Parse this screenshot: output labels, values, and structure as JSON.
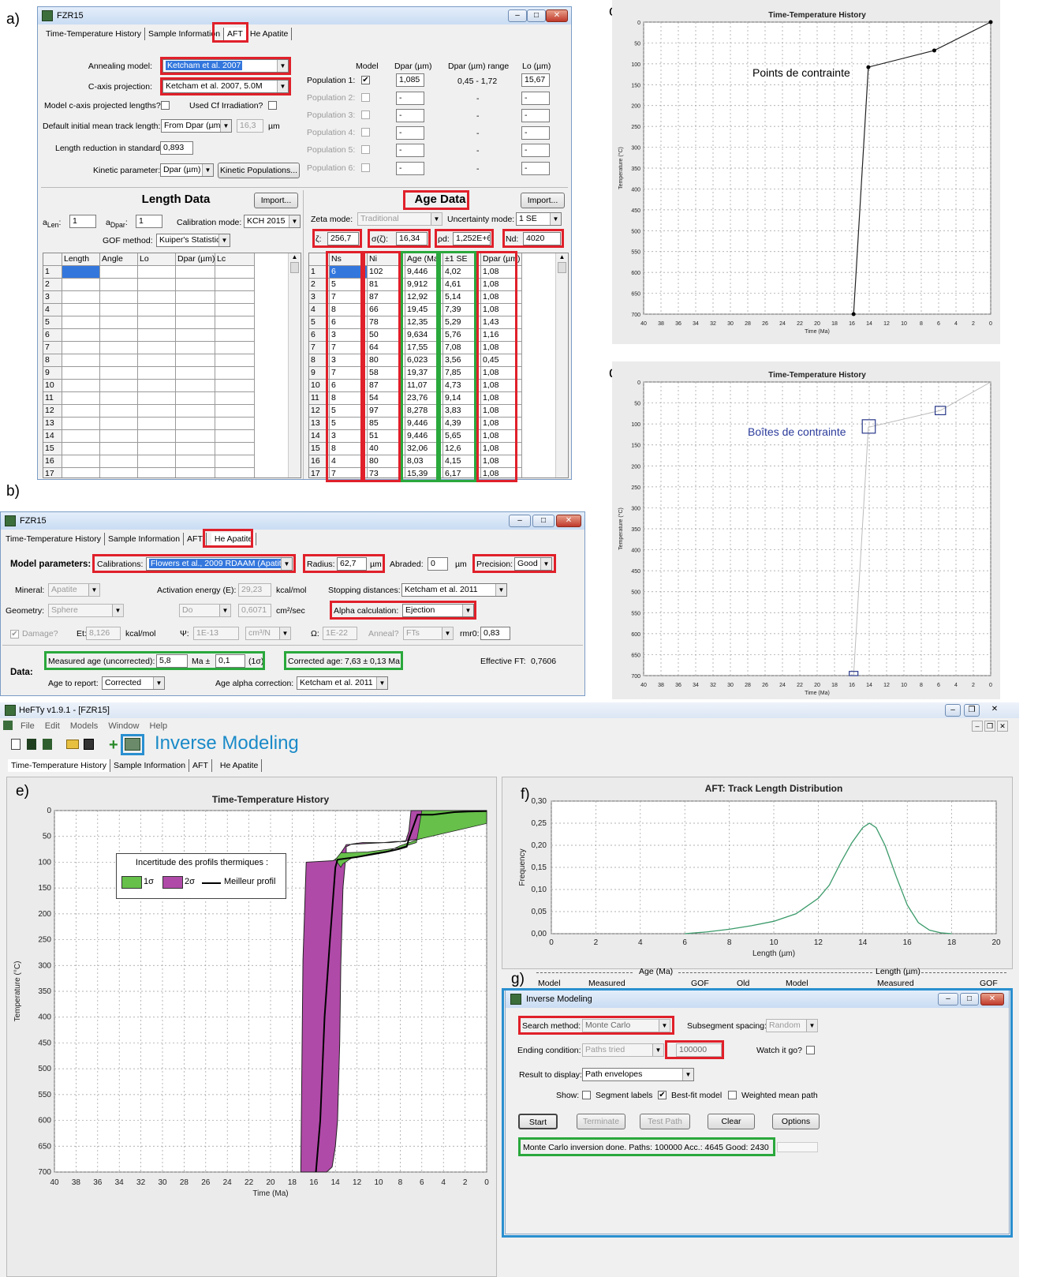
{
  "panel_labels": {
    "a": "a)",
    "b": "b)",
    "c": "c)",
    "d": "d)",
    "e": "e)",
    "f": "f)",
    "g": "g)"
  },
  "aft": {
    "title": "FZR15",
    "tabs": [
      "Time-Temperature History",
      "Sample Information",
      "AFT",
      "He Apatite"
    ],
    "annealing_label": "Annealing model:",
    "annealing_value": "Ketcham et al. 2007",
    "caxis_label": "C-axis projection:",
    "caxis_value": "Ketcham et al. 2007, 5.0M",
    "model_caxis_label": "Model c-axis projected lengths?",
    "used_cf_label": "Used Cf Irradiation?",
    "default_len_label": "Default initial mean track length:",
    "default_len_value": "From Dpar (µm)",
    "default_len_num": "16,3",
    "default_len_unit": "µm",
    "length_red_label": "Length reduction in standard:",
    "length_red_value": "0,893",
    "kinetic_label": "Kinetic parameter:",
    "kinetic_value": "Dpar (µm)",
    "kinetic_btn": "Kinetic Populations...",
    "pop_headers": [
      "Model",
      "Dpar (µm)",
      "Dpar (µm) range",
      "Lo (µm)"
    ],
    "populations": [
      {
        "name": "Population 1:",
        "checked": "✔",
        "dpar": "1,085",
        "range": "0,45 - 1,72",
        "lo": "15,67"
      },
      {
        "name": "Population 2:",
        "checked": "",
        "dpar": "-",
        "range": "-",
        "lo": "-"
      },
      {
        "name": "Population 3:",
        "checked": "",
        "dpar": "-",
        "range": "-",
        "lo": "-"
      },
      {
        "name": "Population 4:",
        "checked": "",
        "dpar": "-",
        "range": "-",
        "lo": "-"
      },
      {
        "name": "Population 5:",
        "checked": "",
        "dpar": "-",
        "range": "-",
        "lo": "-"
      },
      {
        "name": "Population 6:",
        "checked": "",
        "dpar": "-",
        "range": "-",
        "lo": "-"
      }
    ],
    "length_data": {
      "title": "Length Data",
      "import": "Import...",
      "alen_label": "a",
      "alen_sub": "Len",
      "alen_value": "1",
      "adpar_label": "a",
      "adpar_sub": "Dpar",
      "adpar_value": "1",
      "calib_label": "Calibration mode:",
      "calib_value": "KCH 2015",
      "gof_label": "GOF method:",
      "gof_value": "Kuiper's Statistic",
      "headers": [
        "Length",
        "Angle",
        "Lo",
        "Dpar (µm)",
        "Lc"
      ],
      "rows": [
        "1",
        "2",
        "3",
        "4",
        "5",
        "6",
        "7",
        "8",
        "9",
        "10",
        "11",
        "12",
        "13",
        "14",
        "15",
        "16",
        "17"
      ]
    },
    "age_data": {
      "title": "Age Data",
      "import": "Import...",
      "zeta_mode_label": "Zeta mode:",
      "zeta_mode_value": "Traditional",
      "unc_label": "Uncertainty mode:",
      "unc_value": "1 SE",
      "zeta_label": "ζ:",
      "zeta_value": "256,7",
      "szeta_label": "σ(ζ):",
      "szeta_value": "16,34",
      "rho_label": "ρd:",
      "rho_value": "1,252E+6",
      "nd_label": "Nd:",
      "nd_value": "4020",
      "headers": [
        "Ns",
        "Ni",
        "Age (Ma)",
        "±1 SE",
        "Dpar (µm)"
      ],
      "rows": [
        [
          "1",
          "6",
          "102",
          "9,446",
          "4,02",
          "1,08"
        ],
        [
          "2",
          "5",
          "81",
          "9,912",
          "4,61",
          "1,08"
        ],
        [
          "3",
          "7",
          "87",
          "12,92",
          "5,14",
          "1,08"
        ],
        [
          "4",
          "8",
          "66",
          "19,45",
          "7,39",
          "1,08"
        ],
        [
          "5",
          "6",
          "78",
          "12,35",
          "5,29",
          "1,43"
        ],
        [
          "6",
          "3",
          "50",
          "9,634",
          "5,76",
          "1,16"
        ],
        [
          "7",
          "7",
          "64",
          "17,55",
          "7,08",
          "1,08"
        ],
        [
          "8",
          "3",
          "80",
          "6,023",
          "3,56",
          "0,45"
        ],
        [
          "9",
          "7",
          "58",
          "19,37",
          "7,85",
          "1,08"
        ],
        [
          "10",
          "6",
          "87",
          "11,07",
          "4,73",
          "1,08"
        ],
        [
          "11",
          "8",
          "54",
          "23,76",
          "9,14",
          "1,08"
        ],
        [
          "12",
          "5",
          "97",
          "8,278",
          "3,83",
          "1,08"
        ],
        [
          "13",
          "5",
          "85",
          "9,446",
          "4,39",
          "1,08"
        ],
        [
          "14",
          "3",
          "51",
          "9,446",
          "5,65",
          "1,08"
        ],
        [
          "15",
          "8",
          "40",
          "32,06",
          "12,6",
          "1,08"
        ],
        [
          "16",
          "4",
          "80",
          "8,03",
          "4,15",
          "1,08"
        ],
        [
          "17",
          "7",
          "73",
          "15,39",
          "6,17",
          "1,08"
        ]
      ]
    }
  },
  "he": {
    "title": "FZR15",
    "tabs": [
      "Time-Temperature History",
      "Sample Information",
      "AFT",
      "He Apatite"
    ],
    "model_params": "Model parameters:",
    "calib_label": "Calibrations:",
    "calib_value": "Flowers et al., 2009 RDAAM (Apatite)",
    "radius_label": "Radius:",
    "radius_value": "62,7",
    "radius_unit": "µm",
    "abraded_label": "Abraded:",
    "abraded_value": "0",
    "abraded_unit": "µm",
    "precision_label": "Precision:",
    "precision_value": "Good",
    "mineral_label": "Mineral:",
    "mineral_value": "Apatite",
    "act_label": "Activation energy (E):",
    "act_value": "29,23",
    "act_unit": "kcal/mol",
    "stop_label": "Stopping distances:",
    "stop_value": "Ketcham et al. 2011",
    "geom_label": "Geometry:",
    "geom_value": "Sphere",
    "do_value": "Do",
    "do_num": "0,6071",
    "do_unit": "cm²/sec",
    "alpha_label": "Alpha calculation:",
    "alpha_value": "Ejection",
    "damage_label": "Damage?",
    "et_label": "Et:",
    "et_value": "8,126",
    "et_unit": "kcal/mol",
    "psi_label": "Ψ:",
    "psi_value": "1E-13",
    "psi_unit": "cm³/N",
    "omega_label": "Ω:",
    "omega_value": "1E-22",
    "anneal_label": "Anneal?",
    "anneal_value": "FTs",
    "rmr0_label": "rmr0:",
    "rmr0_value": "0,83",
    "data_label": "Data:",
    "measured_label": "Measured age (uncorrected):",
    "measured_value": "5,8",
    "measured_unit": "Ma ±",
    "measured_err": "0,1",
    "measured_sigma": "(1σ)",
    "corrected_label": "Corrected age:",
    "corrected_value": "7,63 ± 0,13 Ma",
    "effective_label": "Effective FT:",
    "effective_value": "0,7606",
    "age_report_label": "Age to report:",
    "age_report_value": "Corrected",
    "age_alpha_label": "Age alpha correction:",
    "age_alpha_value": "Ketcham et al. 2011"
  },
  "hefty": {
    "title": "HeFTy v1.9.1 - [FZR15]",
    "menu": [
      "File",
      "Edit",
      "Models",
      "Window",
      "Help"
    ],
    "inverse_label": "Inverse Modeling",
    "tabs": [
      "Time-Temperature History",
      "Sample Information",
      "AFT",
      "He Apatite"
    ],
    "legend_title": "Incertitude des profils thermiques :",
    "legend_1s": "1σ",
    "legend_2s": "2σ",
    "legend_best": "Meilleur profil",
    "summary_age": "Age (Ma)",
    "summary_length": "Length (µm)",
    "summary_cols": [
      "Model",
      "Measured",
      "GOF",
      "Old",
      "Model",
      "Measured",
      "GOF"
    ]
  },
  "inverse": {
    "title": "Inverse Modeling",
    "search_label": "Search method:",
    "search_value": "Monte Carlo",
    "subseg_label": "Subsegment spacing:",
    "subseg_value": "Random",
    "ending_label": "Ending condition:",
    "ending_value": "Paths tried",
    "ending_num": "100000",
    "watch_label": "Watch it go?",
    "result_label": "Result to display:",
    "result_value": "Path envelopes",
    "show_label": "Show:",
    "seg_label": "Segment labels",
    "best_label": "Best-fit model",
    "wmean_label": "Weighted mean path",
    "btn_start": "Start",
    "btn_terminate": "Terminate",
    "btn_test": "Test Path",
    "btn_clear": "Clear",
    "btn_options": "Options",
    "status": "Monte Carlo inversion done.   Paths: 100000   Acc.: 4645   Good: 2430"
  },
  "annotations": {
    "c": "Points de contrainte",
    "d": "Boîtes de contrainte"
  },
  "chart_data": [
    {
      "id": "c",
      "type": "line",
      "title": "Time-Temperature History",
      "xlabel": "Time (Ma)",
      "ylabel": "Temperature (°C)",
      "xlim": [
        40,
        0
      ],
      "ylim": [
        700,
        0
      ],
      "xticks": [
        40,
        38,
        36,
        34,
        32,
        30,
        28,
        26,
        24,
        22,
        20,
        18,
        16,
        14,
        12,
        10,
        8,
        6,
        4,
        2,
        0
      ],
      "yticks": [
        0,
        50,
        100,
        150,
        200,
        250,
        300,
        350,
        400,
        450,
        500,
        550,
        600,
        650,
        700
      ],
      "series": [
        {
          "x": [
            15.8,
            14.1,
            6.5,
            0
          ],
          "y": [
            700,
            108,
            68,
            0
          ]
        }
      ]
    },
    {
      "id": "d",
      "type": "line",
      "title": "Time-Temperature History",
      "xlabel": "Time (Ma)",
      "ylabel": "Temperature (°C)",
      "xlim": [
        40,
        0
      ],
      "ylim": [
        700,
        0
      ],
      "xticks": [
        40,
        38,
        36,
        34,
        32,
        30,
        28,
        26,
        24,
        22,
        20,
        18,
        16,
        14,
        12,
        10,
        8,
        6,
        4,
        2,
        0
      ],
      "yticks": [
        0,
        50,
        100,
        150,
        200,
        250,
        300,
        350,
        400,
        450,
        500,
        550,
        600,
        650,
        700
      ],
      "series": [
        {
          "x": [
            15.8,
            14.1,
            5.8,
            0
          ],
          "y": [
            700,
            108,
            68,
            0
          ]
        }
      ],
      "boxes": [
        {
          "x": [
            15.3,
            16.3
          ],
          "y": [
            690,
            700
          ]
        },
        {
          "x": [
            13.3,
            14.8
          ],
          "y": [
            90,
            122
          ]
        },
        {
          "x": [
            5.2,
            6.4
          ],
          "y": [
            58,
            78
          ]
        }
      ]
    },
    {
      "id": "e",
      "type": "area",
      "title": "Time-Temperature History",
      "xlabel": "Time (Ma)",
      "ylabel": "Temperature (°C)",
      "xlim": [
        40,
        0
      ],
      "ylim": [
        700,
        0
      ],
      "xticks": [
        40,
        38,
        36,
        34,
        32,
        30,
        28,
        26,
        24,
        22,
        20,
        18,
        16,
        14,
        12,
        10,
        8,
        6,
        4,
        2,
        0
      ],
      "yticks": [
        0,
        50,
        100,
        150,
        200,
        250,
        300,
        350,
        400,
        450,
        500,
        550,
        600,
        650,
        700
      ],
      "envelope_2s": {
        "x": [
          17.2,
          17.0,
          16.7,
          14.2,
          13.8,
          13.1,
          13.0,
          9.5,
          8.5,
          7.5,
          7.2,
          7.0,
          0,
          0,
          4.0,
          5.2,
          6.2,
          8.0,
          9.0,
          11.5,
          12.5,
          13.0,
          13.0,
          13.3,
          13.5,
          13.6,
          13.8,
          14.0,
          14.3,
          14.8,
          15.2,
          16.0,
          16.5,
          17.0
        ],
        "y": [
          700,
          290,
          100,
          97,
          92,
          70,
          66,
          62,
          60,
          60,
          40,
          0,
          0,
          20,
          25,
          27,
          55,
          60,
          62,
          62,
          65,
          70,
          80,
          150,
          300,
          450,
          600,
          650,
          690,
          700,
          700,
          700,
          700,
          700
        ]
      },
      "envelope_1s": {
        "x": [
          14.0,
          13.5,
          11.0,
          8.0,
          6.5,
          6.0,
          1.5,
          0,
          0,
          6.2,
          8.0,
          9.0,
          10.5,
          12.5,
          13.3,
          13.5
        ],
        "y": [
          95,
          82,
          80,
          72,
          62,
          0,
          0,
          0,
          25,
          55,
          68,
          78,
          83,
          92,
          103,
          110
        ]
      },
      "best": {
        "x": [
          15.8,
          15.4,
          15.0,
          14.5,
          14.0,
          13.8,
          12.0,
          9.3,
          8.2,
          7.4,
          7.2,
          6.4,
          5.0,
          3.0,
          1.8,
          0
        ],
        "y": [
          700,
          600,
          400,
          250,
          110,
          95,
          90,
          80,
          75,
          70,
          55,
          8,
          8,
          3,
          2,
          1
        ]
      }
    },
    {
      "id": "f",
      "type": "line",
      "title": "AFT: Track Length Distribution",
      "xlabel": "Length (µm)",
      "ylabel": "Frequency",
      "xlim": [
        0,
        20
      ],
      "ylim": [
        0,
        0.3
      ],
      "xticks": [
        0,
        2,
        4,
        6,
        8,
        10,
        12,
        14,
        16,
        18,
        20
      ],
      "yticks": [
        "0,00",
        "0,05",
        "0,10",
        "0,15",
        "0,20",
        "0,25",
        "0,30"
      ],
      "series": [
        {
          "x": [
            6,
            7,
            8,
            9,
            10,
            11,
            12,
            12.5,
            13,
            13.5,
            14,
            14.3,
            14.6,
            15,
            15.5,
            16,
            16.5,
            17,
            17.5,
            18
          ],
          "y": [
            0,
            0.004,
            0.01,
            0.018,
            0.028,
            0.045,
            0.08,
            0.11,
            0.16,
            0.205,
            0.24,
            0.25,
            0.24,
            0.2,
            0.13,
            0.065,
            0.025,
            0.008,
            0.002,
            0
          ]
        }
      ]
    }
  ]
}
